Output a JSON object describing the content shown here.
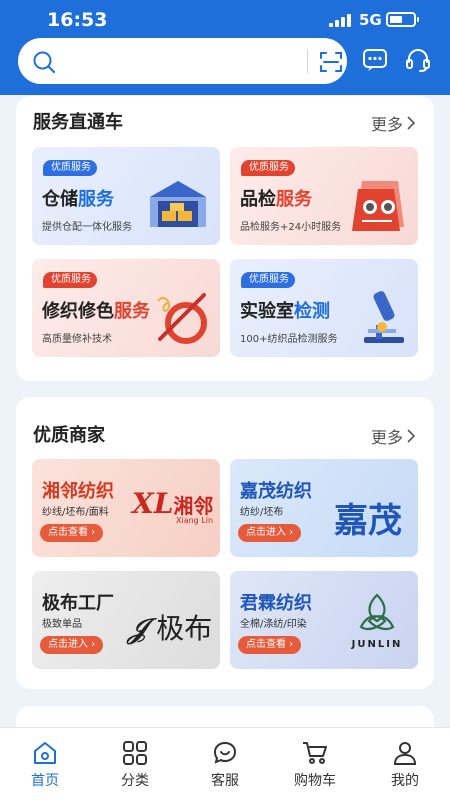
{
  "status_bar": {
    "time": "16:53",
    "network": "5G"
  },
  "header": {
    "search": {
      "placeholder": ""
    },
    "icons": [
      "search-icon",
      "scan-icon",
      "message-icon",
      "headset-icon"
    ]
  },
  "services": {
    "title": "服务直通车",
    "more": "更多",
    "tiles": [
      {
        "tag": "优质服务",
        "title_plain": "仓储",
        "title_highlight": "服务",
        "subtitle": "提供仓配一体化服务",
        "icon": "warehouse-icon"
      },
      {
        "tag": "优质服务",
        "title_plain": "品检",
        "title_highlight": "服务",
        "subtitle": "品检服务+24小时服务",
        "icon": "inspection-icon"
      },
      {
        "tag": "优质服务",
        "title_plain": "修织修色",
        "title_highlight": "服务",
        "subtitle": "高质量修补技术",
        "icon": "needle-thread-icon"
      },
      {
        "tag": "优质服务",
        "title_plain": "实验室",
        "title_highlight": "检测",
        "subtitle": "100+纺织品检测服务",
        "icon": "microscope-icon"
      }
    ]
  },
  "merchants": {
    "title": "优质商家",
    "more": "更多",
    "items": [
      {
        "name": "湘邻纺织",
        "desc": "纱线/坯布/面料",
        "button": "点击查看",
        "logo_text": "湘邻",
        "logo_sub": "Xiang Lin"
      },
      {
        "name": "嘉茂纺织",
        "desc": "纺纱/坯布",
        "button": "点击进入",
        "logo_text": "嘉茂"
      },
      {
        "name": "极布工厂",
        "desc": "极致单品",
        "button": "点击进入",
        "logo_text": "极布"
      },
      {
        "name": "君霖纺织",
        "desc": "全棉/涤纺/印染",
        "button": "点击查看",
        "logo_text": "JUNLIN"
      }
    ]
  },
  "tabbar": {
    "tabs": [
      {
        "label": "首页",
        "icon": "home-icon",
        "active": true
      },
      {
        "label": "分类",
        "icon": "grid-icon",
        "active": false
      },
      {
        "label": "客服",
        "icon": "chat-icon",
        "active": false
      },
      {
        "label": "购物车",
        "icon": "cart-icon",
        "active": false
      },
      {
        "label": "我的",
        "icon": "user-icon",
        "active": false
      }
    ]
  },
  "colors": {
    "brand": "#1e6fd9",
    "accent_red": "#e0432f",
    "accent_blue": "#1e6fd9"
  }
}
